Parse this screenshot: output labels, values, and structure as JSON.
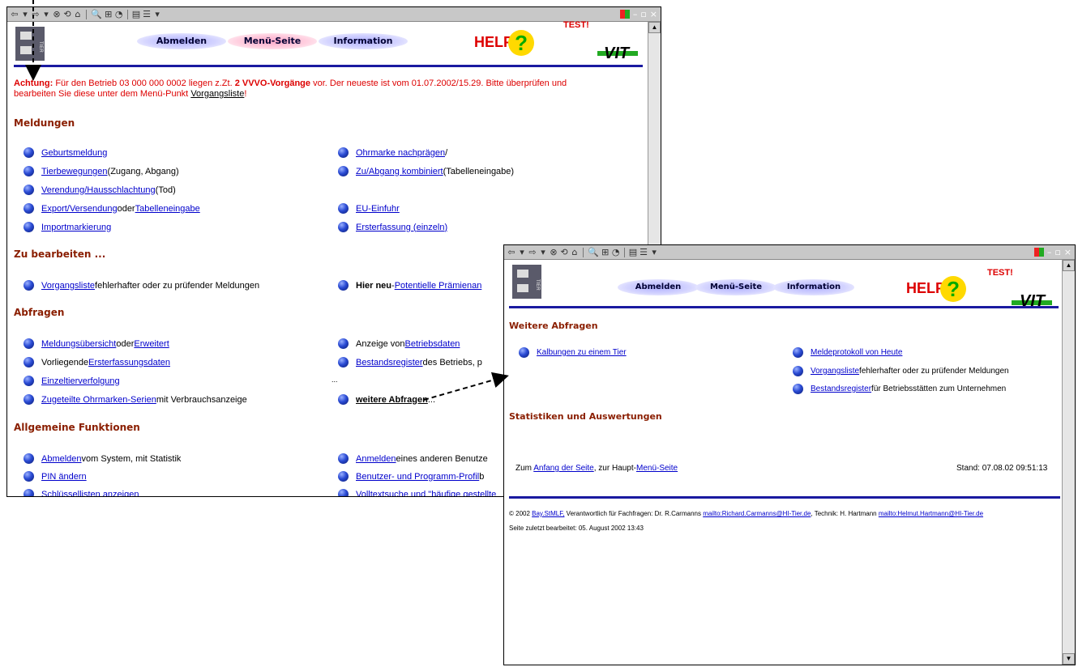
{
  "toolbar": {
    "glyphs": [
      "⇦",
      "▾",
      "⇨",
      "▾",
      "⊗",
      "⟲",
      "⌂",
      "🔍",
      "⊞",
      "◔",
      "▤",
      "☰",
      "▾"
    ]
  },
  "header": {
    "logout": "Abmelden",
    "menu": "Menü-Seite",
    "info": "Information",
    "help": "HELP",
    "test": "TEST!",
    "vit": "VIT",
    "tier": "TIER"
  },
  "main": {
    "warning": {
      "achtung": "Achtung:",
      "text1": " Für den Betrieb 03 000 000 0002 liegen z.Zt. ",
      "bold": "2 VVVO-Vorgänge",
      "text2": " vor. Der neueste ist vom 01.07.2002/15.29. Bitte überprüfen und",
      "text3": "bearbeiten Sie diese unter dem Menü-Punkt ",
      "link": "Vorgangsliste",
      "end": "!"
    },
    "sections": {
      "meldungen": "Meldungen",
      "zubearbeiten": "Zu bearbeiten ...",
      "abfragen": "Abfragen",
      "allgemein": "Allgemeine Funktionen"
    },
    "meldungen": {
      "geburt": "Geburtsmeldung",
      "tierbew": "Tierbewegungen",
      "tierbew_rest": " (Zugang, Abgang)",
      "verend": "Verendung/Hausschlachtung",
      "verend_rest": " (Tod)",
      "export": "Export/Versendung",
      "export_oder": " oder ",
      "tabelle": "Tabelleneingabe",
      "import": "Importmarkierung",
      "ohrmarke": "Ohrmarke nachprägen",
      "ohrmarke_rest": " /",
      "zuab": "Zu/Abgang kombiniert",
      "zuab_rest": " (Tabelleneingabe)",
      "eu": "EU-Einfuhr",
      "erst": "Ersterfassung (einzeln)"
    },
    "zubearbeiten": {
      "vl": "Vorgangsliste",
      "vl_rest": " fehlerhafter oder zu prüfender Meldungen",
      "hier": "Hier neu",
      "hier_dash": " - ",
      "prem": "Potentielle Prämienan"
    },
    "abfragen": {
      "mu": "Meldungsübersicht",
      "mu_oder": " oder ",
      "erw": "Erweitert",
      "vorl": "Vorliegende ",
      "efd": "Ersterfassungsdaten",
      "ezt": "Einzeltierverfolgung",
      "zoms": "Zugeteilte Ohrmarken-Serien",
      "zoms_rest": " mit Verbrauchsanzeige",
      "anz": "Anzeige von ",
      "bd": "Betriebsdaten",
      "br": "Bestandsregister",
      "br_rest": " des Betriebs, p",
      "dots": "...",
      "wa": "weitere Abfragen",
      "wa_rest": " ..."
    },
    "allgemein": {
      "abm": "Abmelden",
      "abm_rest": " vom System, mit Statistik",
      "pin": "PIN ändern",
      "schl": "Schlüssellisten anzeigen",
      "anm": "Anmelden",
      "anm_rest": " eines anderen Benutze",
      "bpp": "Benutzer- und Programm-Profil",
      "bpp_rest": " b",
      "volltext": "Volltextsuche und \"häufige gestellte"
    }
  },
  "second": {
    "weitere": "Weitere Abfragen",
    "kalb": "Kalbungen zu einem Tier",
    "mp": "Meldeprotokoll von Heute",
    "vl": "Vorgangsliste",
    "vl_rest": " fehlerhafter oder zu prüfender Meldungen",
    "br": "Bestandsregister",
    "br_rest": " für Betriebsstätten zum Unternehmen",
    "stat": "Statistiken und Auswertungen",
    "zum": "Zum ",
    "anfang": "Anfang der Seite",
    "zum2": ",  zur Haupt-",
    "menu": "Menü-Seite",
    "stand": "Stand: 07.08.02 09:51:13",
    "footer1a": "© 2002 ",
    "bay": "Bay.StMLF,",
    "footer1b": " Verantwortlich für Fachfragen: Dr. R.Carmanns ",
    "mail1": "mailto:Richard.Carmanns@HI-Tier.de",
    "footer1c": ", Technik: H. Hartmann ",
    "mail2": "mailto:Helmut.Hartmann@HI-Tier.de",
    "footer2": "Seite zuletzt bearbeitet: 05. August 2002 13:43"
  },
  "colors": {
    "warning": "#dd0000",
    "section": "#8a1e00",
    "link": "#0000cc",
    "rule": "#1a1aa0"
  }
}
